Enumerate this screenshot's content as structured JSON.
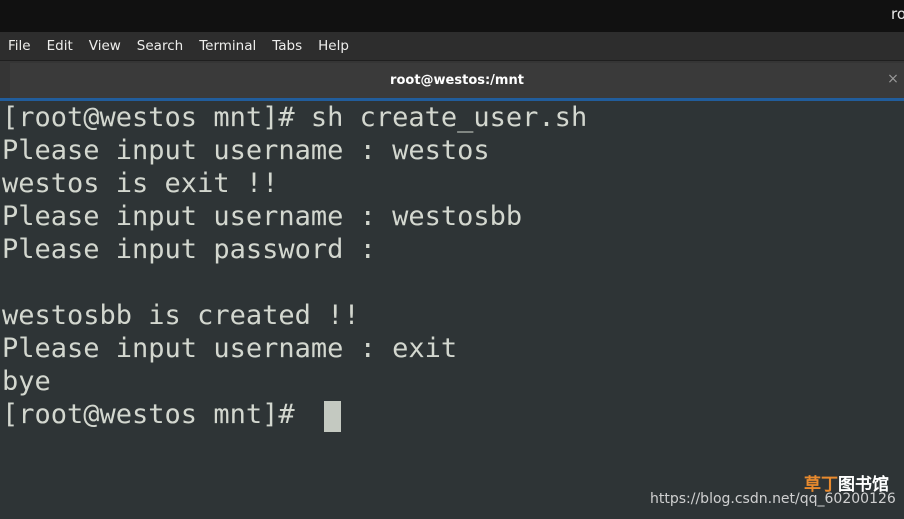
{
  "topbar": {
    "user": "ro"
  },
  "menu": [
    "File",
    "Edit",
    "View",
    "Search",
    "Terminal",
    "Tabs",
    "Help"
  ],
  "tab": {
    "title": "root@westos:/mnt",
    "close": "×"
  },
  "terminal": {
    "lines": [
      "[root@westos mnt]# sh create_user.sh",
      "Please input username : westos",
      "westos is exit !!",
      "Please input username : westosbb",
      "Please input password :",
      "",
      "westosbb is created !!",
      "Please input username : exit",
      "bye",
      "[root@westos mnt]# "
    ]
  },
  "watermark": {
    "logo_part1": "草丁",
    "logo_part2": "图书馆",
    "url": "https://blog.csdn.net/qq_60200126"
  },
  "colors": {
    "terminal_bg": "#2e3436",
    "terminal_fg": "#d3d7cf",
    "tab_accent": "#215d9c"
  }
}
